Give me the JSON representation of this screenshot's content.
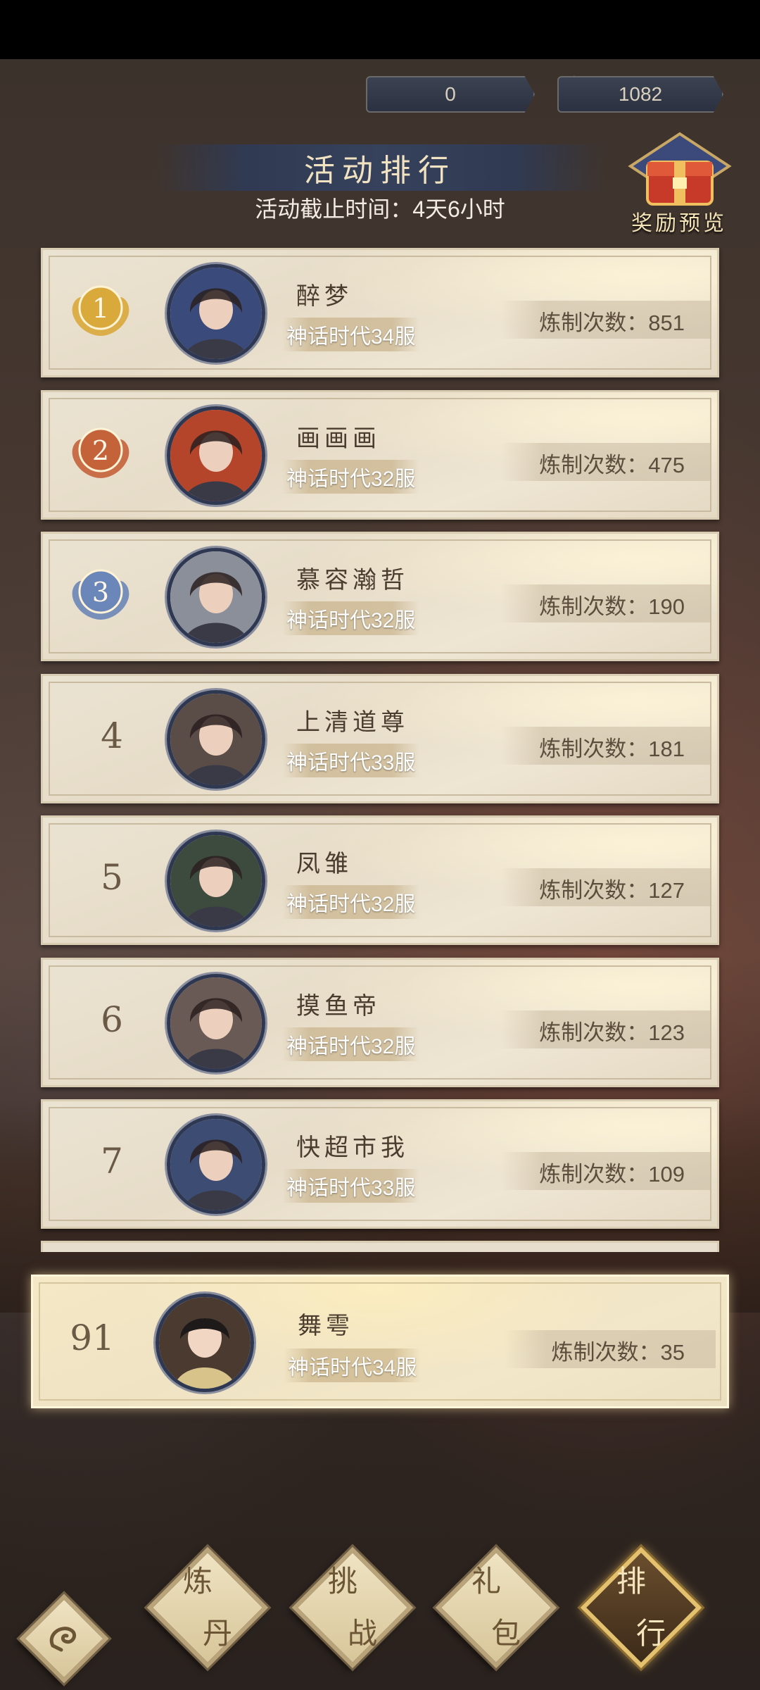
{
  "currency": {
    "first": {
      "icon": "gold-bird-icon",
      "value": "0"
    },
    "second": {
      "icon": "jade-coin-icon",
      "value": "1082"
    }
  },
  "header": {
    "title": "活动排行",
    "deadline": "活动截止时间：4天6小时",
    "reward_preview_label": "奖励预览"
  },
  "rank_rows": [
    {
      "rank": "1",
      "medal": "gold",
      "name": "醉梦",
      "server": "神话时代34服",
      "score": "炼制次数：851",
      "avatar_color": "#3a4a7a"
    },
    {
      "rank": "2",
      "medal": "bronze",
      "name": "画画画",
      "server": "神话时代32服",
      "score": "炼制次数：475",
      "avatar_color": "#b4452a"
    },
    {
      "rank": "3",
      "medal": "blue",
      "name": "慕容瀚哲",
      "server": "神话时代32服",
      "score": "炼制次数：190",
      "avatar_color": "#8a8f9a"
    },
    {
      "rank": "4",
      "medal": "",
      "name": "上清道尊",
      "server": "神话时代33服",
      "score": "炼制次数：181",
      "avatar_color": "#5a4d48"
    },
    {
      "rank": "5",
      "medal": "",
      "name": "凤雏",
      "server": "神话时代32服",
      "score": "炼制次数：127",
      "avatar_color": "#3d4a3e"
    },
    {
      "rank": "6",
      "medal": "",
      "name": "摸鱼帝",
      "server": "神话时代32服",
      "score": "炼制次数：123",
      "avatar_color": "#6a5a55"
    },
    {
      "rank": "7",
      "medal": "",
      "name": "快超市我",
      "server": "神话时代33服",
      "score": "炼制次数：109",
      "avatar_color": "#3d4c72"
    }
  ],
  "my_row": {
    "rank": "91",
    "name": "舞雩",
    "server": "神话时代34服",
    "score": "炼制次数：35",
    "avatar_color": "#4a3a30"
  },
  "nav": {
    "back": {
      "icon": "swirl-back-icon"
    },
    "items": [
      {
        "c1": "炼",
        "c2": "丹",
        "active": false
      },
      {
        "c1": "挑",
        "c2": "战",
        "active": false
      },
      {
        "c1": "礼",
        "c2": "包",
        "active": false
      },
      {
        "c1": "排",
        "c2": "行",
        "active": true
      }
    ]
  },
  "colors": {
    "medal_gold": "#d9a93c",
    "medal_bronze": "#c4623a",
    "medal_blue": "#6b86b8",
    "accent": "#e4c16f"
  }
}
